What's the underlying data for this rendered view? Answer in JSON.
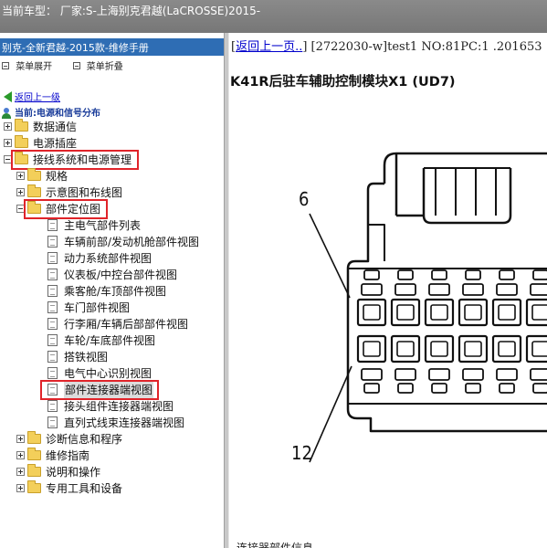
{
  "title_bar": {
    "text": "当前车型： 厂家:S-上海别克君越(LaCROSSE)2015-"
  },
  "left_panel": {
    "manual_title": "别克-全新君越-2015款-维修手册",
    "toolbar": {
      "expand_label": "菜单展开",
      "collapse_label": "菜单折叠"
    },
    "back_link": "返回上一级",
    "current_location": "当前:电源和信号分布",
    "tree": [
      {
        "label": "数据通信",
        "level": 0,
        "type": "folder",
        "expander": "plus"
      },
      {
        "label": "电源插座",
        "level": 0,
        "type": "folder",
        "expander": "plus"
      },
      {
        "label": "接线系统和电源管理",
        "level": 0,
        "type": "folder",
        "expander": "minus",
        "highlighted": true
      },
      {
        "label": "规格",
        "level": 1,
        "type": "folder",
        "expander": "plus"
      },
      {
        "label": "示意图和布线图",
        "level": 1,
        "type": "folder",
        "expander": "plus"
      },
      {
        "label": "部件定位图",
        "level": 1,
        "type": "folder",
        "expander": "minus",
        "highlighted": true
      },
      {
        "label": "主电气部件列表",
        "level": 2,
        "type": "document"
      },
      {
        "label": "车辆前部/发动机舱部件视图",
        "level": 2,
        "type": "document"
      },
      {
        "label": "动力系统部件视图",
        "level": 2,
        "type": "document"
      },
      {
        "label": "仪表板/中控台部件视图",
        "level": 2,
        "type": "document"
      },
      {
        "label": "乘客舱/车顶部件视图",
        "level": 2,
        "type": "document"
      },
      {
        "label": "车门部件视图",
        "level": 2,
        "type": "document"
      },
      {
        "label": "行李厢/车辆后部部件视图",
        "level": 2,
        "type": "document"
      },
      {
        "label": "车轮/车底部件视图",
        "level": 2,
        "type": "document"
      },
      {
        "label": "搭铁视图",
        "level": 2,
        "type": "document"
      },
      {
        "label": "电气中心识别视图",
        "level": 2,
        "type": "document"
      },
      {
        "label": "部件连接器端视图",
        "level": 2,
        "type": "document",
        "highlighted": true,
        "selected": true
      },
      {
        "label": "接头组件连接器端视图",
        "level": 2,
        "type": "document"
      },
      {
        "label": "直列式线束连接器端视图",
        "level": 2,
        "type": "document"
      },
      {
        "label": "诊断信息和程序",
        "level": 1,
        "type": "folder",
        "expander": "plus"
      },
      {
        "label": "维修指南",
        "level": 1,
        "type": "folder",
        "expander": "plus"
      },
      {
        "label": "说明和操作",
        "level": 1,
        "type": "folder",
        "expander": "plus"
      },
      {
        "label": "专用工具和设备",
        "level": 1,
        "type": "folder",
        "expander": "plus"
      }
    ]
  },
  "right_panel": {
    "nav_open": "[",
    "back_link": "返回上一页..",
    "nav_close": "]",
    "doc_info": " [2722030-w]test1 NO:81PC:1 .201653",
    "heading": "K41R后驻车辅助控制模块X1 (UD7)",
    "pin_top_label": "6",
    "pin_bottom_label": "12",
    "bottom_text": "连接器部件信息"
  },
  "colors": {
    "title_bar_bg": "#808080",
    "manual_title_bg": "#2e6db4",
    "highlight_border": "#e0242a",
    "link": "#0000cc",
    "folder": "#f3cf5a"
  }
}
